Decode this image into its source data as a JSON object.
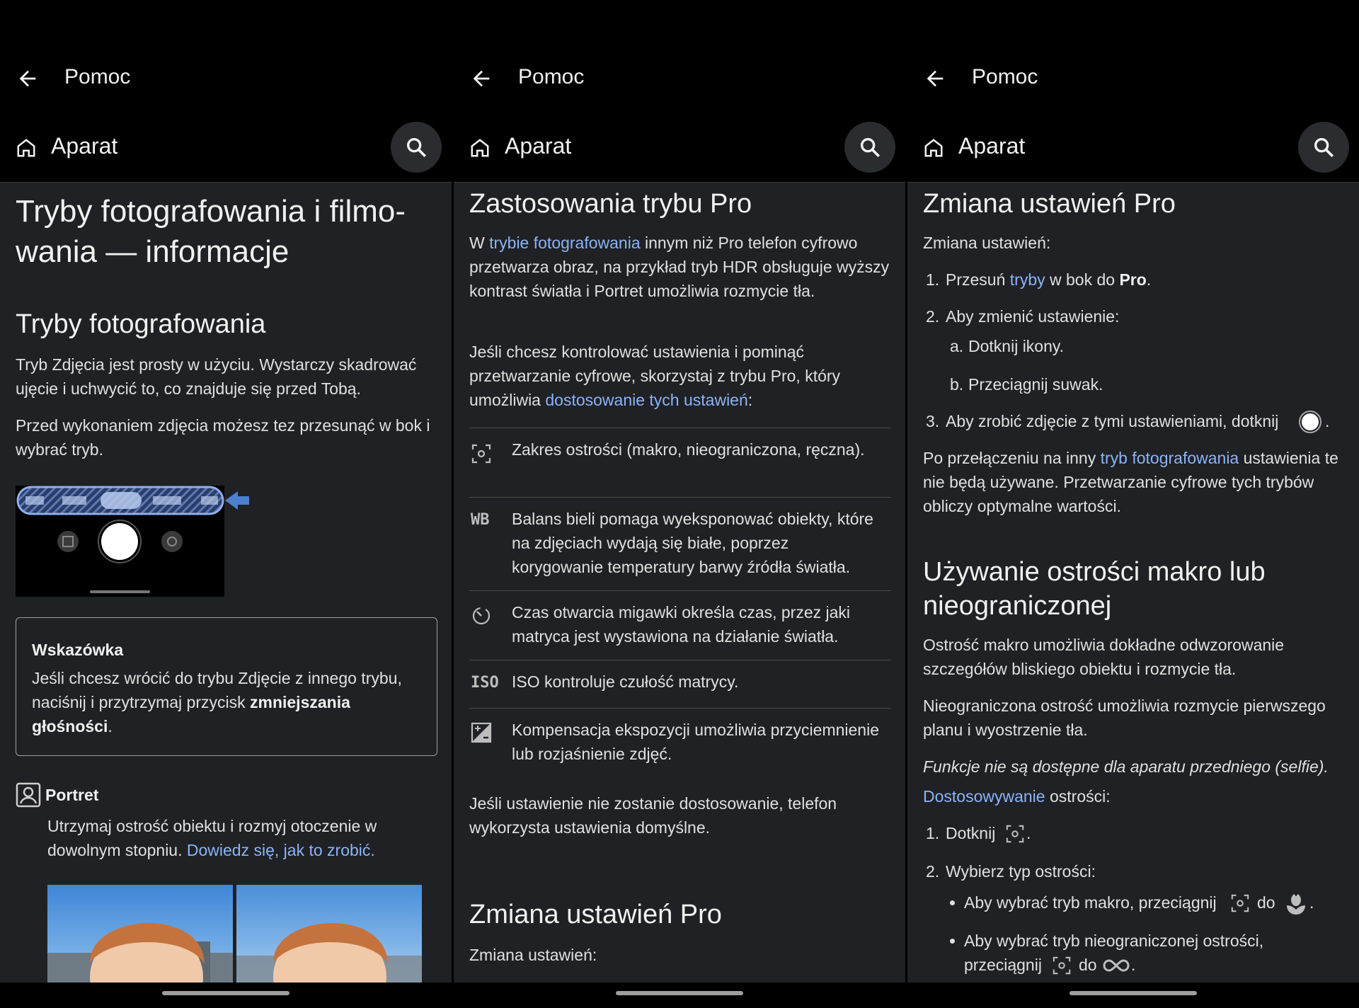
{
  "header": {
    "title": "Pomoc",
    "breadcrumb": "Aparat"
  },
  "panel1": {
    "heading": "Tryby fotografowania i filmo-wania — informacje",
    "heading_line1": "Tryby fotografowania i filmo-",
    "heading_line2": "wania — informacje",
    "section_title": "Tryby fotografowania",
    "p1": "Tryb Zdjęcia jest prosty w użyciu. Wystarczy skadrować ujęcie i uchwycić to, co znajduje się przed Tobą.",
    "p2": "Przed wykonaniem zdjęcia możesz tez przesunąć w bok i wybrać tryb.",
    "tip": {
      "title": "Wskazówka",
      "text_before": "Jeśli chcesz wrócić do trybu Zdjęcie z innego trybu, naciśnij i przytrzymaj przycisk ",
      "bold": "zmniejszania głośności",
      "text_after": "."
    },
    "portrait": {
      "label": "Portret",
      "text": "Utrzymaj ostrość obiektu i rozmyj otoczenie w dowolnym stopniu. ",
      "link": "Dowiedz się, jak to zrobić."
    }
  },
  "panel2": {
    "heading": "Zastosowania trybu Pro",
    "intro_before": "W ",
    "intro_link": "trybie fotografowania",
    "intro_after": " innym niż Pro telefon cyfrowo przetwarza obraz, na przykład tryb HDR obsługuje wyższy kontrast światła i Portret umożliwia rozmycie tła.",
    "p2_before": "Jeśli chcesz kontrolować ustawienia i pominąć przetwarzanie cyfrowe, skorzystaj z trybu Pro, który umożliwia ",
    "p2_link": "dostosowanie tych ustawień",
    "p2_after": ":",
    "features": [
      {
        "icon": "focus-icon",
        "text": "Zakres ostrości (makro, nieograniczona, ręczna)."
      },
      {
        "icon": "white-balance-icon",
        "text": "Balans bieli pomaga wyeksponować obiekty, które na zdjęciach wydają się białe, poprzez korygowanie temperatury barwy źródła światła."
      },
      {
        "icon": "shutter-speed-icon",
        "text": "Czas otwarcia migawki określa czas, przez jaki matryca jest wystawiona na działanie światła."
      },
      {
        "icon": "iso-icon",
        "text": "ISO kontroluje czułość matrycy."
      },
      {
        "icon": "exposure-icon",
        "text": "Kompensacja ekspozycji umożliwia przyciemnienie lub rozjaśnienie zdjęć."
      }
    ],
    "wb_glyph": "WB",
    "iso_glyph": "ISO",
    "default_note": "Jeśli ustawienie nie zostanie dostosowanie, telefon wykorzysta ustawienia domyślne.",
    "sub_heading": "Zmiana ustawień Pro",
    "sub_text": "Zmiana ustawień:"
  },
  "panel3": {
    "heading": "Zmiana ustawień Pro",
    "lead": "Zmiana ustawień:",
    "step1_num": "1.",
    "step1_before": "Przesuń ",
    "step1_link": "tryby",
    "step1_mid": " w bok do ",
    "step1_bold": "Pro",
    "step1_after": ".",
    "step2_num": "2.",
    "step2": "Aby zmienić ustawienie:",
    "step2a_num": "a.",
    "step2a": "Dotknij ikony.",
    "step2b_num": "b.",
    "step2b": "Przeciągnij suwak.",
    "step3_num": "3.",
    "step3": "Aby zrobić zdjęcie z tymi ustawieniami, dotknij",
    "step3_after": ".",
    "p_before": "Po przełączeniu na inny ",
    "p_link": "tryb fotografowania",
    "p_after": " ustawienia te nie będą używane. Przetwarzanie cyfrowe tych trybów obliczy optymalne wartości.",
    "section2": "Używanie ostrości makro lub nieograniczonej",
    "macro_text": "Ostrość makro umożliwia dokładne odwzorowanie szczegółów bliskiego obiektu i rozmycie tła.",
    "infinite_text": "Nieograniczona ostrość umożliwia rozmycie pierwszego planu i wyostrzenie tła.",
    "note": "Funkcje nie są dostępne dla aparatu przedniego (selfie).",
    "adjust_link": "Dostosowywanie",
    "adjust_after": " ostrości:",
    "s1_num": "1.",
    "s1": "Dotknij",
    "s1_after": ".",
    "s2_num": "2.",
    "s2": "Wybierz typ ostrości:",
    "bullet1": "Aby wybrać tryb makro, przeciągnij",
    "bullet1_do": "do",
    "bullet1_after": ".",
    "bullet2_line1": "Aby wybrać tryb nieograniczonej ostrości,",
    "bullet2_line2": "przeciągnij",
    "bullet2_do": "do",
    "bullet2_after": "."
  }
}
